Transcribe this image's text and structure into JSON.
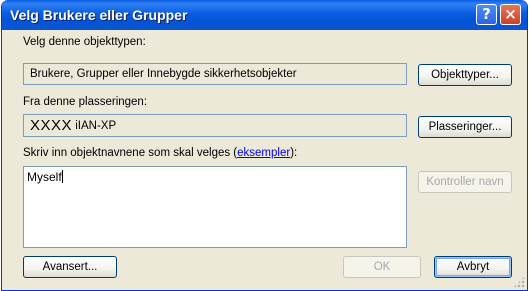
{
  "window": {
    "title": "Velg Brukere eller Grupper",
    "help_label": "?",
    "close_label": "×"
  },
  "object_type": {
    "label": "Velg denne objekttypen:",
    "value": "Brukere, Grupper eller Innebygde sikkerhetsobjekter",
    "button": "Objekttyper..."
  },
  "location": {
    "label": "Fra denne plasseringen:",
    "value_prefix": "XXXX",
    "value": "iIAN-XP",
    "button": "Plasseringer..."
  },
  "names": {
    "label_before": "Skriv inn objektnavnene som skal velges (",
    "link": "eksempler",
    "label_after": "):",
    "value": "Myself",
    "check_button": "Kontroller navn"
  },
  "footer": {
    "advanced_button": "Avansert...",
    "ok_button": "OK",
    "cancel_button": "Avbryt"
  }
}
